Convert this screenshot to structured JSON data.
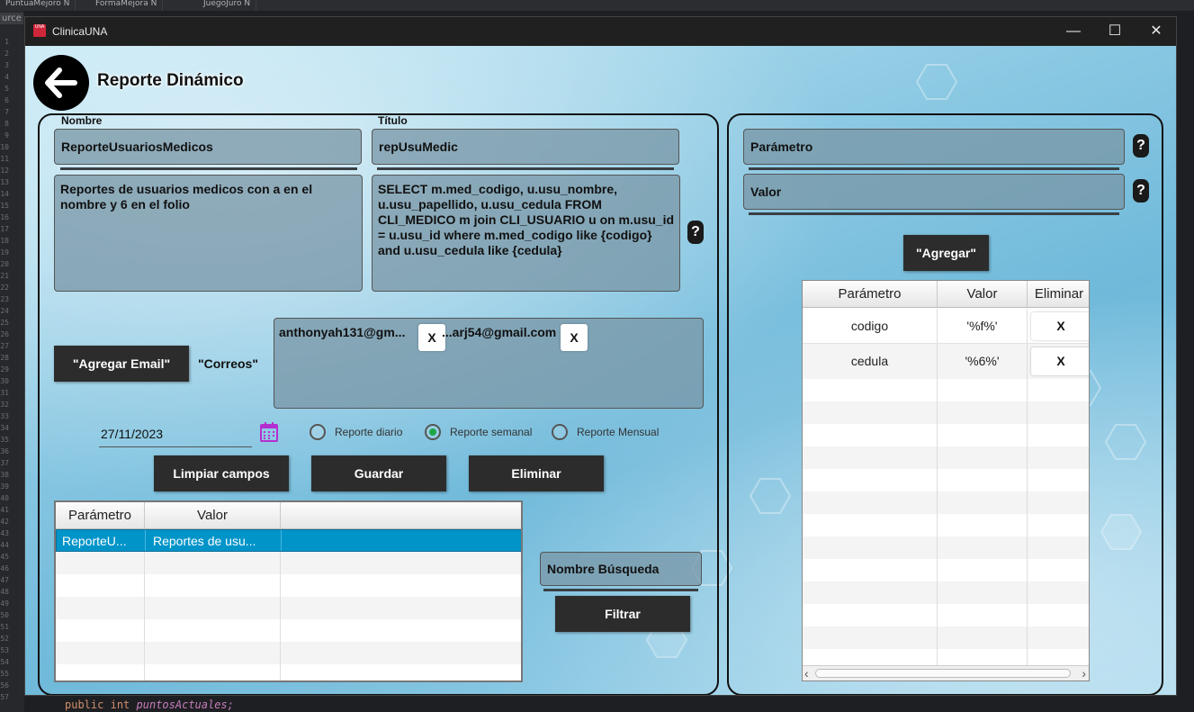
{
  "ide": {
    "tabs": [
      "PuntuaMejoro N",
      "FormaMejora N",
      "JuegoJuro N"
    ],
    "source_label": "urce",
    "line_numbers": [
      "1",
      "2",
      "3",
      "4",
      "5",
      "6",
      "7",
      "8",
      "9",
      "10",
      "11",
      "12",
      "13",
      "14",
      "15",
      "16",
      "17",
      "18",
      "19",
      "20",
      "21",
      "22",
      "23",
      "24",
      "25",
      "26",
      "27",
      "28",
      "29",
      "30",
      "31",
      "32",
      "33",
      "34",
      "35",
      "36",
      "37",
      "38",
      "39",
      "40",
      "41",
      "42",
      "43",
      "44",
      "45",
      "46",
      "47",
      "48",
      "49",
      "50",
      "51",
      "52",
      "53",
      "54",
      "55",
      "56",
      "57"
    ],
    "code_keyword1": "public",
    "code_keyword2": "int",
    "code_field": "puntosActuales;"
  },
  "window": {
    "title": "ClinicaUNA",
    "icon_text": "UNA",
    "minimize_glyph": "—",
    "maximize_glyph": "☐",
    "close_glyph": "✕"
  },
  "page": {
    "title": "Reporte Dinámico"
  },
  "form": {
    "name_label": "Nombre",
    "name_value": "ReporteUsuariosMedicos",
    "title_label": "Título",
    "title_value": "repUsuMedic",
    "description": "Reportes de usuarios medicos con a en el nombre y 6 en el folio",
    "query": "SELECT m.med_codigo, u.usu_nombre, u.usu_papellido, u.usu_cedula FROM CLI_MEDICO m join CLI_USUARIO u on m.usu_id = u.usu_id where m.med_codigo like {codigo} and u.usu_cedula like {cedula}",
    "help_glyph": "?",
    "add_email_button": "\"Agregar Email\"",
    "emails_label": "\"Correos\"",
    "emails": [
      {
        "text": "anthonyah131@gm...",
        "remove": "X"
      },
      {
        "text": "...arj54@gmail.com",
        "remove": "X"
      }
    ],
    "date_value": "27/11/2023",
    "frequency_options": [
      {
        "label": "Reporte diario",
        "selected": false
      },
      {
        "label": "Reporte semanal",
        "selected": true
      },
      {
        "label": "Reporte Mensual",
        "selected": false
      }
    ],
    "clear_button": "Limpiar campos",
    "save_button": "Guardar",
    "delete_button": "Eliminar"
  },
  "reports_table": {
    "columns": [
      "Parámetro",
      "Valor"
    ],
    "rows": [
      {
        "param": "ReporteU...",
        "value": "Reportes de usu..."
      }
    ]
  },
  "search": {
    "placeholder": "Nombre Búsqueda",
    "filter_button": "Filtrar"
  },
  "params": {
    "param_placeholder": "Parámetro",
    "value_placeholder": "Valor",
    "help_glyph": "?",
    "add_button": "\"Agregar\"",
    "columns": [
      "Parámetro",
      "Valor",
      "Eliminar"
    ],
    "rows": [
      {
        "param": "codigo",
        "value": "'%f%'",
        "remove": "X"
      },
      {
        "param": "cedula",
        "value": "'%6%'",
        "remove": "X"
      }
    ],
    "scroll_left": "‹",
    "scroll_right": "›"
  },
  "colors": {
    "selected_row": "#0094c9",
    "radio_selected": "#1fa64a",
    "dark_button": "#2c2c2c"
  }
}
